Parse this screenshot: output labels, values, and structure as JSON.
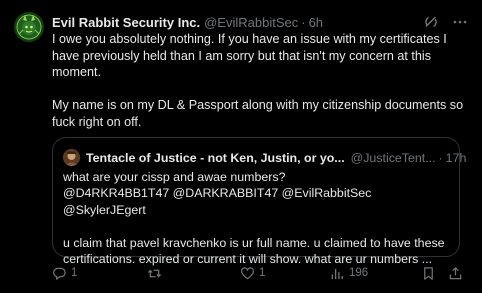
{
  "tweet": {
    "display_name": "Evil Rabbit Security Inc.",
    "handle": "@EvilRabbitSec",
    "separator": "·",
    "time": "6h",
    "text": "I owe you absolutely nothing. If you have an issue with my certificates I have previously held than I am sorry but that isn't my concern at this moment.\n\nMy name is on my DL & Passport along with my citizenship documents so fuck right on off."
  },
  "quote": {
    "display_name": "Tentacle of Justice - not Ken, Justin, or yo...",
    "handle": "@JusticeTent...",
    "separator": "·",
    "time": "17h",
    "text": "what are your cissp and awae numbers?\n@D4RKR4BB1T47 @DARKRABBIT47 @EvilRabbitSec @SkylerJEgert\n\nu claim that pavel kravchenko is ur full name. u claimed to have these certifications. expired or current it will show. what are ur numbers ..."
  },
  "actions": {
    "replies": "1",
    "reposts": "",
    "likes": "1",
    "views": "196"
  },
  "icons": {
    "header": [
      "grok-icon",
      "more-icon"
    ],
    "action_bar": [
      "reply-icon",
      "repost-icon",
      "like-icon",
      "views-icon",
      "bookmark-icon",
      "share-icon"
    ]
  },
  "colors": {
    "background": "#000000",
    "text": "#e7e9ea",
    "muted": "#71767b",
    "border": "#2f3336"
  }
}
